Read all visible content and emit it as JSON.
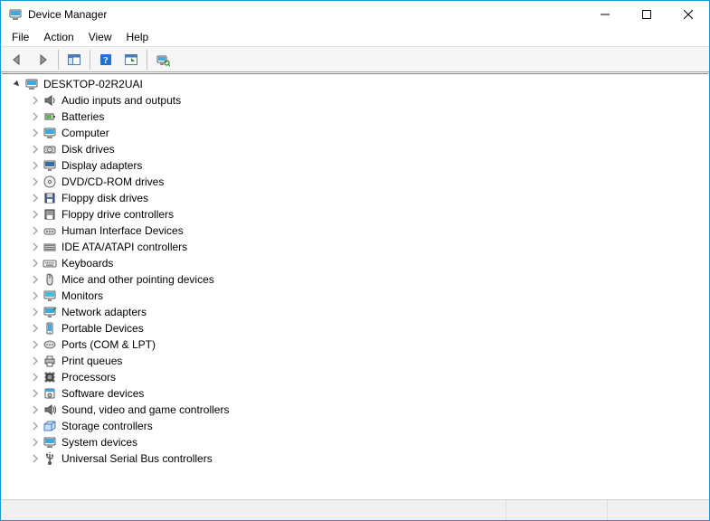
{
  "window": {
    "title": "Device Manager"
  },
  "menubar": {
    "file": "File",
    "action": "Action",
    "view": "View",
    "help": "Help"
  },
  "tree": {
    "root_label": "DESKTOP-02R2UAI",
    "items": [
      {
        "label": "Audio inputs and outputs"
      },
      {
        "label": "Batteries"
      },
      {
        "label": "Computer"
      },
      {
        "label": "Disk drives"
      },
      {
        "label": "Display adapters"
      },
      {
        "label": "DVD/CD-ROM drives"
      },
      {
        "label": "Floppy disk drives"
      },
      {
        "label": "Floppy drive controllers"
      },
      {
        "label": "Human Interface Devices"
      },
      {
        "label": "IDE ATA/ATAPI controllers"
      },
      {
        "label": "Keyboards"
      },
      {
        "label": "Mice and other pointing devices"
      },
      {
        "label": "Monitors"
      },
      {
        "label": "Network adapters"
      },
      {
        "label": "Portable Devices"
      },
      {
        "label": "Ports (COM & LPT)"
      },
      {
        "label": "Print queues"
      },
      {
        "label": "Processors"
      },
      {
        "label": "Software devices"
      },
      {
        "label": "Sound, video and game controllers"
      },
      {
        "label": "Storage controllers"
      },
      {
        "label": "System devices"
      },
      {
        "label": "Universal Serial Bus controllers"
      }
    ]
  }
}
